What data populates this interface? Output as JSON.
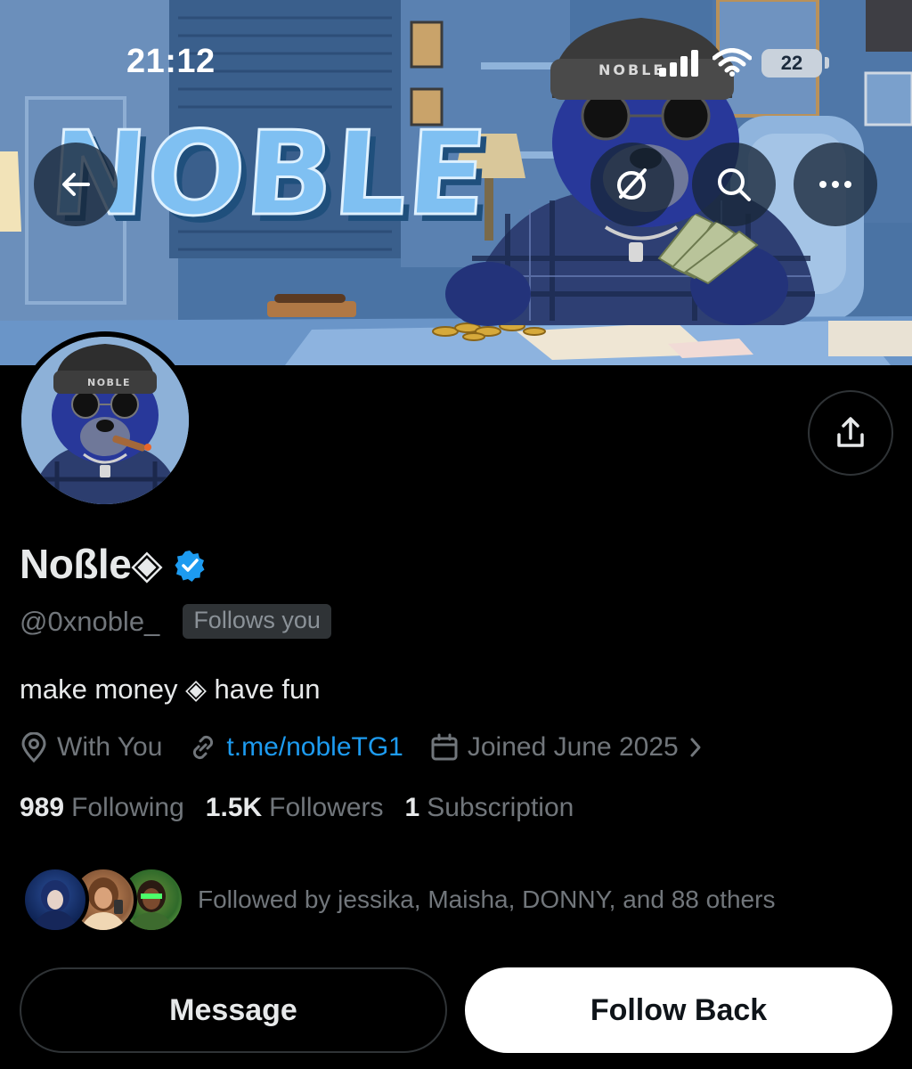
{
  "status_bar": {
    "time": "21:12",
    "battery": "22"
  },
  "banner": {
    "logo_text": "NOBLE",
    "beanie_text": "NOBLE"
  },
  "nav": {
    "back_icon": "arrow-left-icon",
    "grok_icon": "grok-icon",
    "search_icon": "search-icon",
    "more_icon": "more-horizontal-icon"
  },
  "avatar": {
    "beanie_text": "NOBLE"
  },
  "profile": {
    "display_name": "Noßle◈",
    "handle": "@0xnoble_",
    "follows_you": "Follows you",
    "bio": "make money ◈ have fun",
    "location": "With You",
    "link": "t.me/nobleTG1",
    "joined": "Joined June 2025",
    "following_count": "989",
    "following_label": "Following",
    "followers_count": "1.5K",
    "followers_label": "Followers",
    "subscriptions_count": "1",
    "subscriptions_label": "Subscription",
    "followed_by": "Followed by jessika, Maisha, DONNY, and 88 others"
  },
  "actions": {
    "message_label": "Message",
    "follow_back_label": "Follow Back"
  },
  "colors": {
    "accent": "#1d9bf0",
    "background": "#000000",
    "secondary_text": "#71767b",
    "verified": "#1d9bf0"
  }
}
